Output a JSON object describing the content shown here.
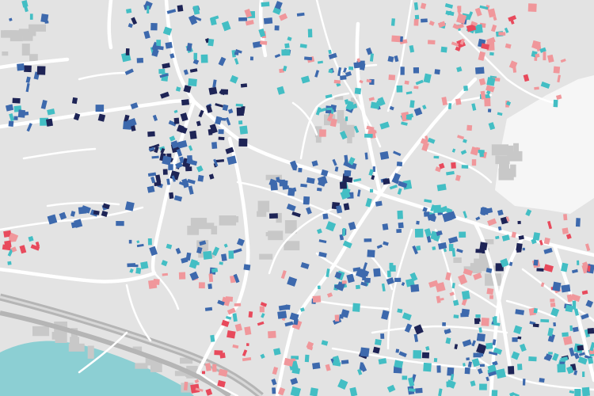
{
  "map": {
    "colors": {
      "land": "#e3e3e3",
      "water": "#8ccfd3",
      "road": "#ffffff",
      "road_casing": "#cfcfcf",
      "rail": "#a8a8a8",
      "unclassified_building": "#c8c8c8",
      "snow_patch": "#f6f6f6"
    },
    "building_categories": [
      {
        "key": "navy",
        "color": "#1e2456"
      },
      {
        "key": "blue",
        "color": "#3d69ad"
      },
      {
        "key": "teal",
        "color": "#43bec4"
      },
      {
        "key": "pink",
        "color": "#f0979b"
      },
      {
        "key": "red",
        "color": "#e84a5c"
      }
    ]
  }
}
